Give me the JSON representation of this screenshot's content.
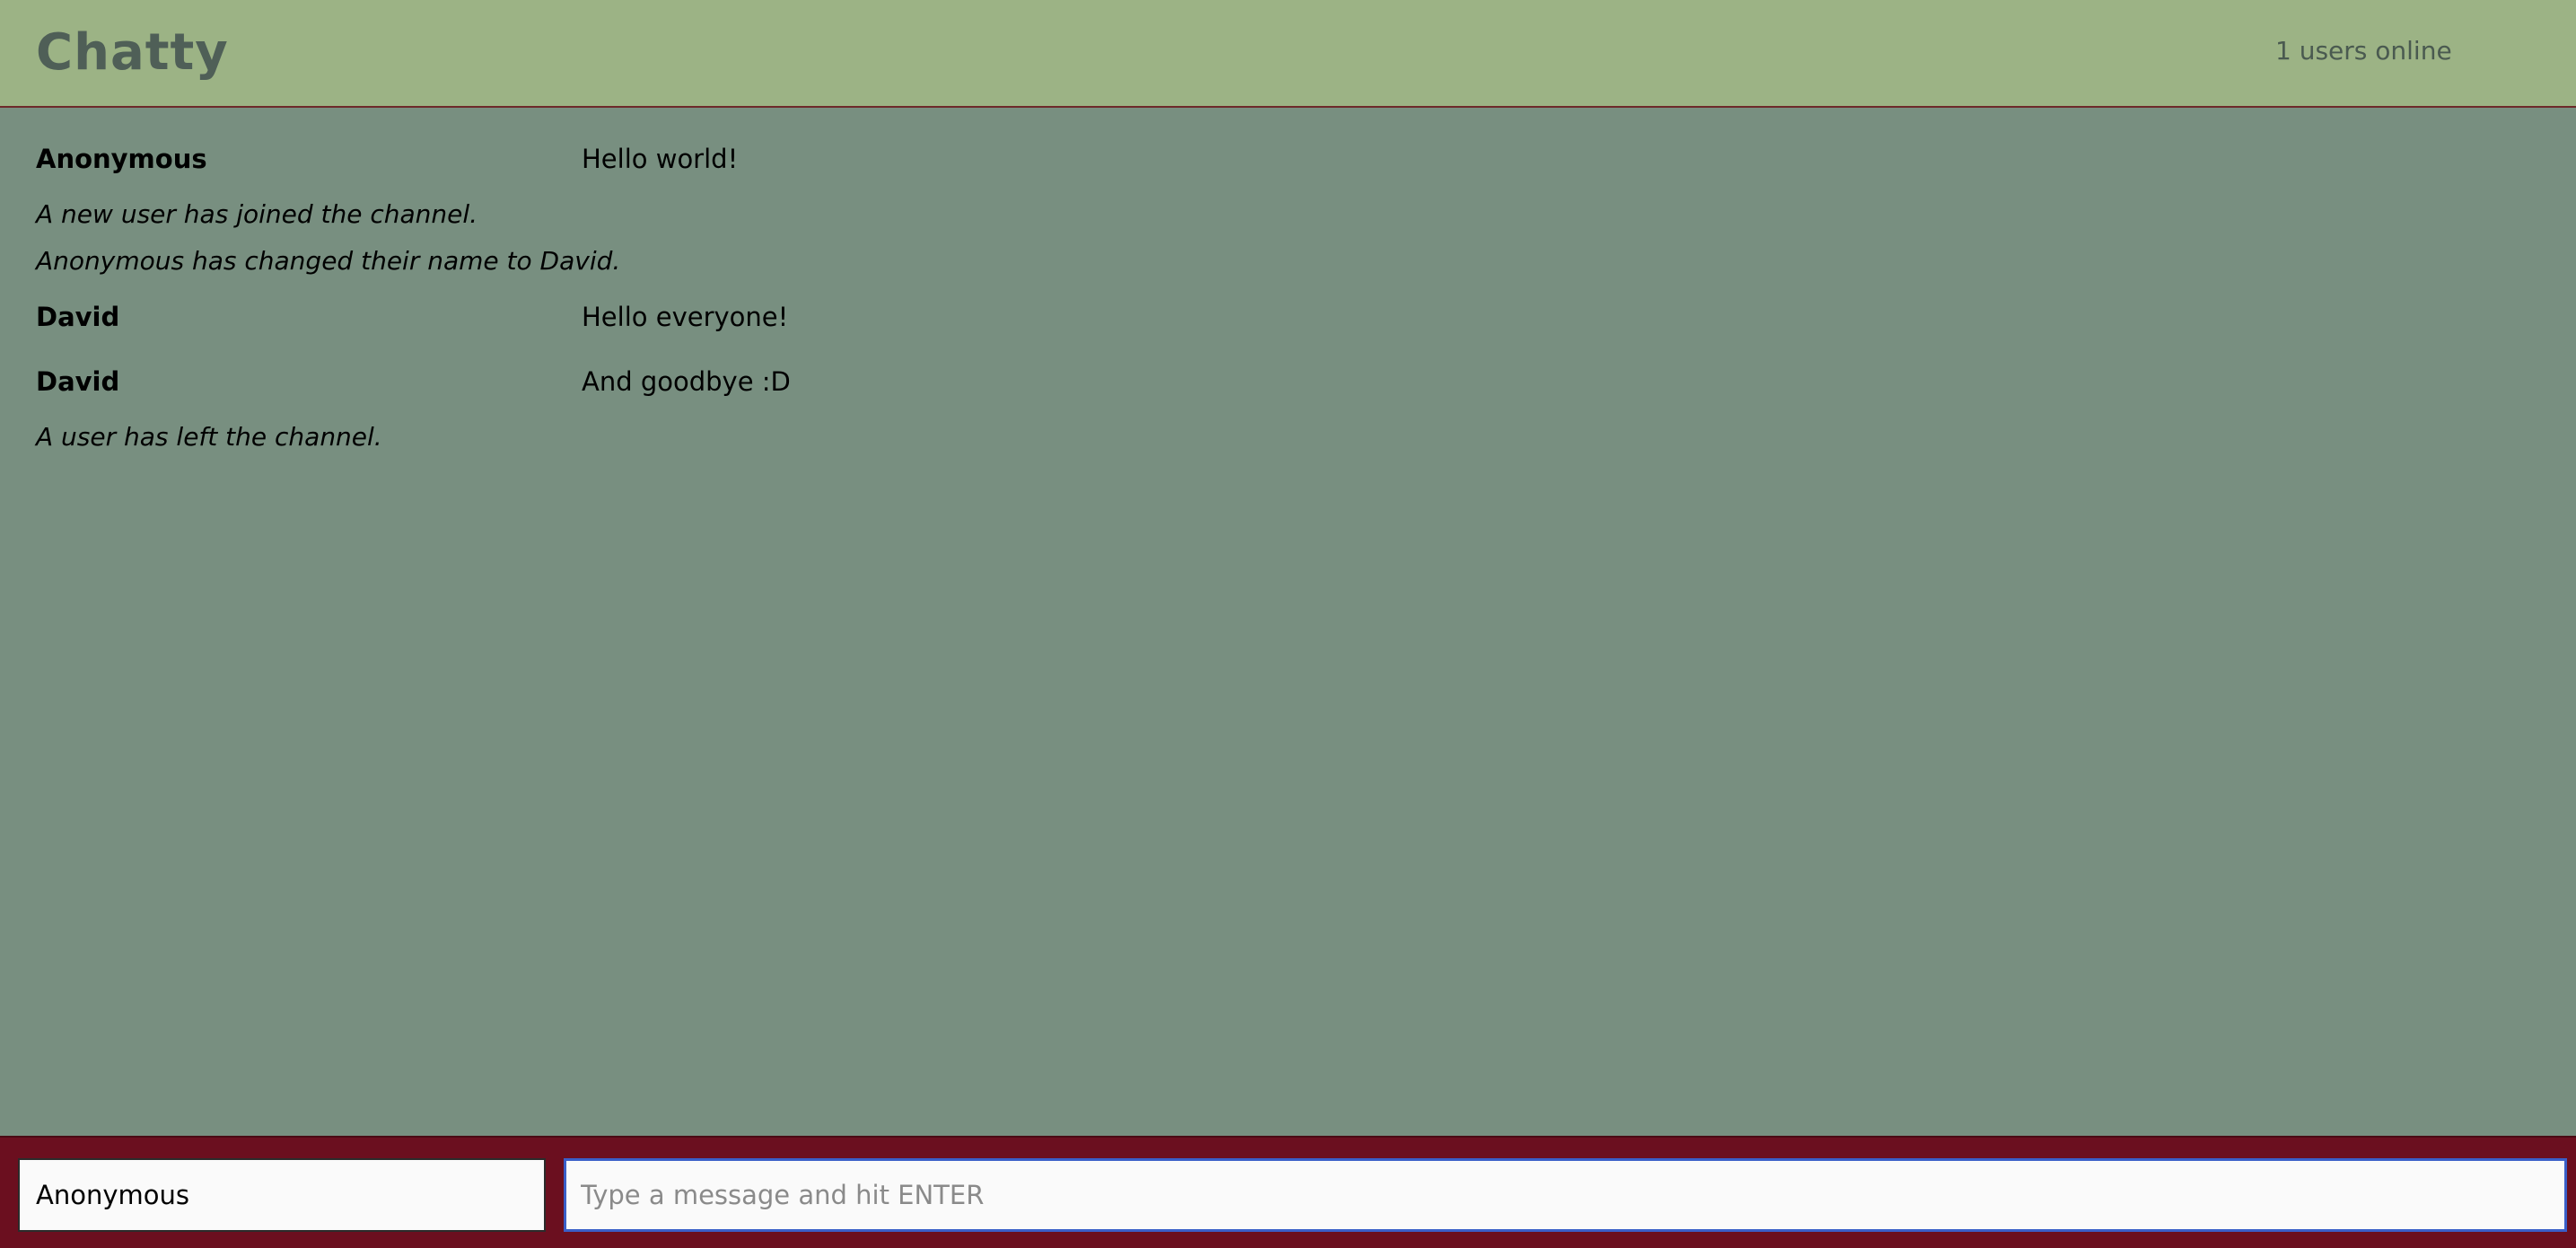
{
  "navbar": {
    "brand": "Chatty",
    "users_online": "1 users online"
  },
  "messages": [
    {
      "type": "message",
      "user": "Anonymous",
      "content": "Hello world!"
    },
    {
      "type": "system",
      "content": "A new user has joined the channel."
    },
    {
      "type": "system",
      "content": "Anonymous has changed their name to David."
    },
    {
      "type": "message",
      "user": "David",
      "content": "Hello everyone!"
    },
    {
      "type": "message",
      "user": "David",
      "content": "And goodbye :D"
    },
    {
      "type": "system",
      "content": "A user has left the channel."
    }
  ],
  "footer": {
    "username_value": "Anonymous",
    "message_placeholder": "Type a message and hit ENTER"
  },
  "colors": {
    "navbar_bg": "#9cb385",
    "messages_bg": "#788f80",
    "footer_bg": "#6b0f1f",
    "focus_border": "#3a5fc8"
  }
}
